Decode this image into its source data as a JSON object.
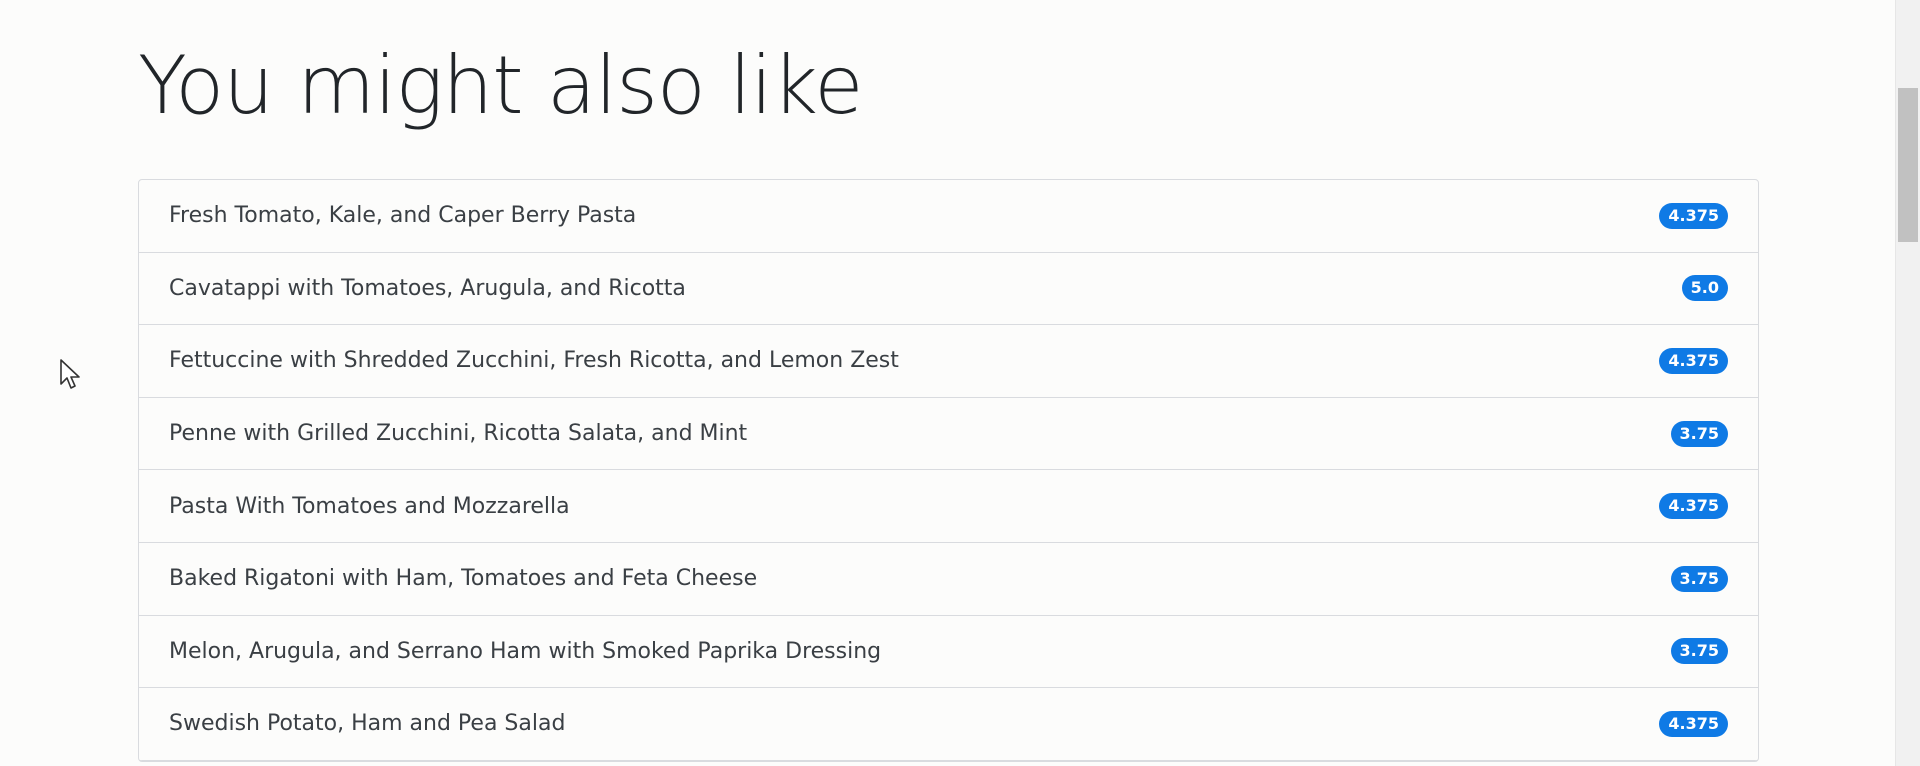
{
  "section": {
    "title": "You might also like"
  },
  "recipes": [
    {
      "name": "Fresh Tomato, Kale, and Caper Berry Pasta",
      "rating": "4.375"
    },
    {
      "name": "Cavatappi with Tomatoes, Arugula, and Ricotta",
      "rating": "5.0"
    },
    {
      "name": "Fettuccine with Shredded Zucchini, Fresh Ricotta, and Lemon Zest",
      "rating": "4.375"
    },
    {
      "name": "Penne with Grilled Zucchini, Ricotta Salata, and Mint",
      "rating": "3.75"
    },
    {
      "name": "Pasta With Tomatoes and Mozzarella",
      "rating": "4.375"
    },
    {
      "name": "Baked Rigatoni with Ham, Tomatoes and Feta Cheese",
      "rating": "3.75"
    },
    {
      "name": "Melon, Arugula, and Serrano Ham with Smoked Paprika Dressing",
      "rating": "3.75"
    },
    {
      "name": "Swedish Potato, Ham and Pea Salad",
      "rating": "4.375"
    }
  ],
  "colors": {
    "badge": "#0f7ae5",
    "text": "#3a3f44",
    "heading": "#212529",
    "border": "#d9dbdf"
  },
  "icons": {
    "cursor": "mouse-pointer-icon"
  }
}
